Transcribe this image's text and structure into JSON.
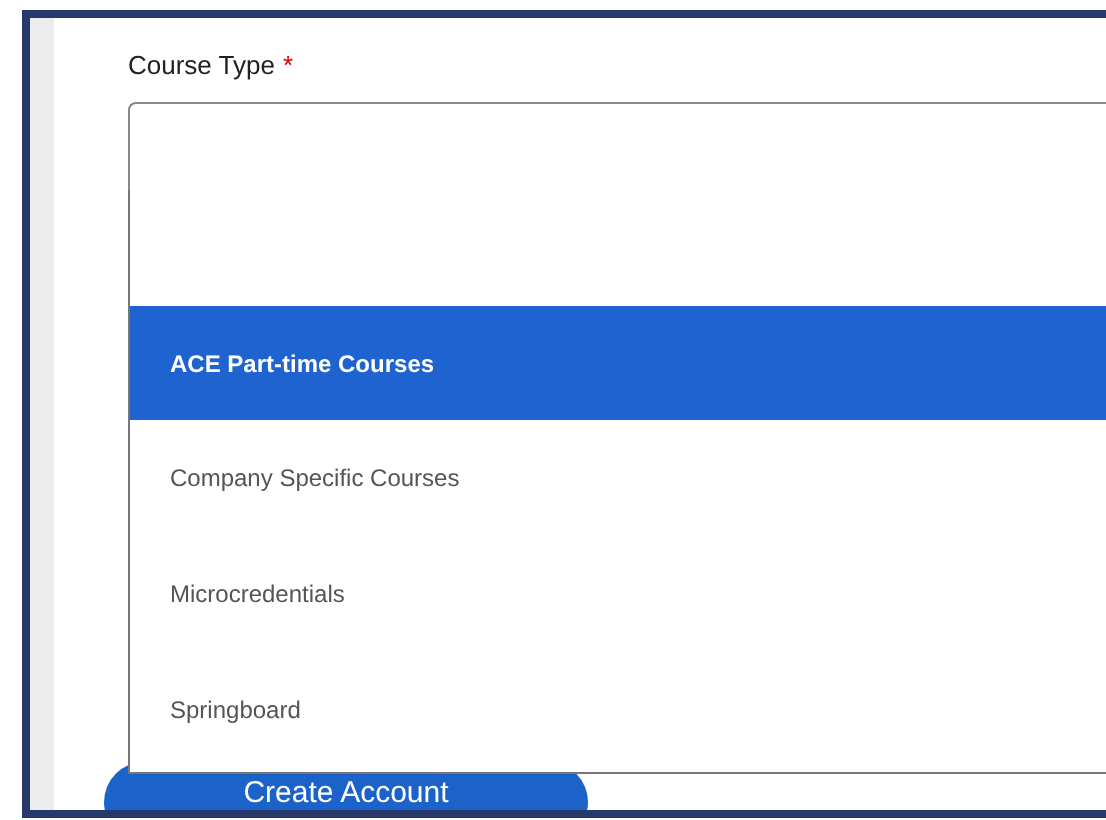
{
  "field": {
    "label": "Course Type",
    "required_mark": "*"
  },
  "options": [
    {
      "label": "ACE Part-time Courses",
      "selected": true
    },
    {
      "label": "Company Specific Courses",
      "selected": false
    },
    {
      "label": "Microcredentials",
      "selected": false
    },
    {
      "label": "Springboard",
      "selected": false
    }
  ],
  "button": {
    "label": "Create Account"
  }
}
